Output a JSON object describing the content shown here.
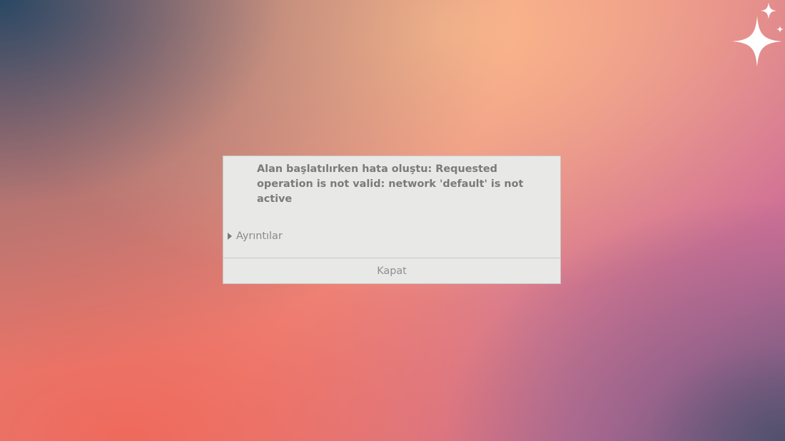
{
  "dialog": {
    "message": "Alan başlatılırken hata oluştu: Requested operation is not valid: network 'default' is not active",
    "details_label": "Ayrıntılar",
    "close_label": "Kapat"
  },
  "icons": {
    "details_expander": "triangle-right-icon",
    "corner_decoration": "sparkle-icon"
  },
  "colors": {
    "dialog_background": "#e8e8e7",
    "text": "#7a7a7a"
  }
}
